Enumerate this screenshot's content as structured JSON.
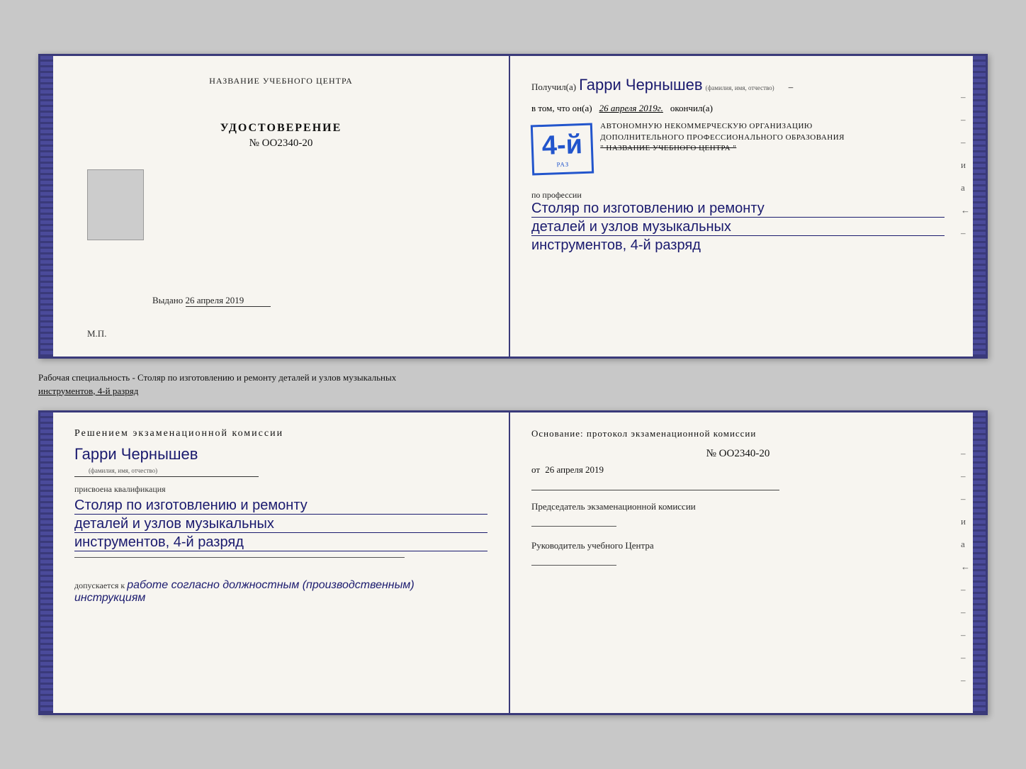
{
  "top_spread": {
    "left_page": {
      "header": "НАЗВАНИЕ УЧЕБНОГО ЦЕНТРА",
      "cert_title": "УДОСТОВЕРЕНИЕ",
      "cert_number": "№ OO2340-20",
      "issued_label": "Выдано",
      "issued_date": "26 апреля 2019",
      "mp_label": "М.П."
    },
    "right_page": {
      "recipient_prefix": "Получил(а)",
      "recipient_name": "Гарри Чернышев",
      "name_hint": "(фамилия, имя, отчество)",
      "dash": "–",
      "in_that": "в том, что он(а)",
      "date": "26 апреля 2019г.",
      "finished": "окончил(а)",
      "stamp_number": "4-й",
      "stamp_subtitle": "раз",
      "org_line1": "АВТОНОМНУЮ НЕКОММЕРЧЕСКУЮ ОРГАНИЗАЦИЮ",
      "org_line2": "ДОПОЛНИТЕЛЬНОГО ПРОФЕССИОНАЛЬНОГО ОБРАЗОВАНИЯ",
      "org_line3": "\" НАЗВАНИЕ УЧЕБНОГО ЦЕНТРА \"",
      "prof_label": "по профессии",
      "qualification_line1": "Столяр по изготовлению и ремонту",
      "qualification_line2": "деталей и узлов музыкальных",
      "qualification_line3": "инструментов, 4-й разряд"
    }
  },
  "caption": {
    "text": "Рабочая специальность - Столяр по изготовлению и ремонту деталей и узлов музыкальных",
    "text2": "инструментов, 4-й разряд"
  },
  "bottom_spread": {
    "left_page": {
      "decision_title": "Решением экзаменационной комиссии",
      "person_name": "Гарри Чернышев",
      "name_hint": "(фамилия, имя, отчество)",
      "assigned_label": "присвоена квалификация",
      "qual_line1": "Столяр по изготовлению и ремонту",
      "qual_line2": "деталей и узлов музыкальных",
      "qual_line3": "инструментов, 4-й разряд",
      "allowed_prefix": "допускается к",
      "allowed_text": "работе согласно должностным (производственным) инструкциям"
    },
    "right_page": {
      "basis_label": "Основание: протокол экзаменационной комиссии",
      "protocol_number": "№ OO2340-20",
      "date_prefix": "от",
      "date": "26 апреля 2019",
      "commission_title": "Председатель экзаменационной комиссии",
      "center_leader": "Руководитель учебного Центра"
    }
  },
  "side_dashes": [
    "–",
    "–",
    "–",
    "и",
    "а",
    "←",
    "–",
    "–",
    "–",
    "–",
    "–"
  ]
}
